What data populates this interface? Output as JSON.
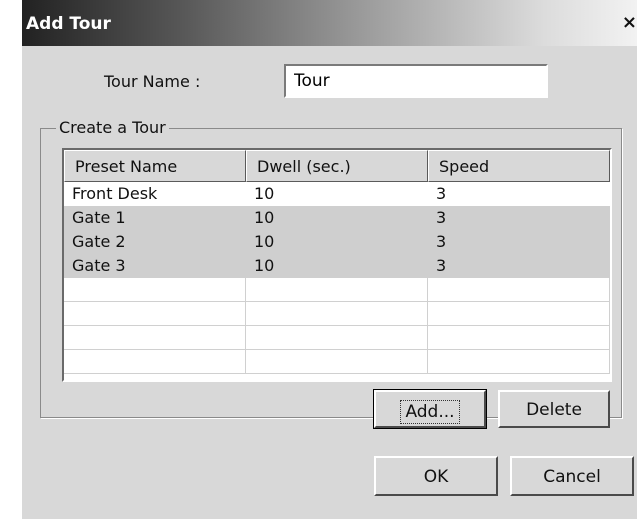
{
  "window": {
    "title": "Add Tour",
    "close_glyph": "×",
    "close_icon": "close-icon"
  },
  "tour_name": {
    "label": "Tour Name :",
    "value": "Tour"
  },
  "group": {
    "legend": "Create a Tour"
  },
  "table": {
    "columns": [
      "Preset Name",
      "Dwell (sec.)",
      "Speed"
    ],
    "rows": [
      [
        "Front Desk",
        "10",
        "3"
      ],
      [
        "Gate 1",
        "10",
        "3"
      ],
      [
        "Gate 2",
        "10",
        "3"
      ],
      [
        "Gate 3",
        "10",
        "3"
      ]
    ]
  },
  "buttons": {
    "add": "Add...",
    "delete": "Delete",
    "ok": "OK",
    "cancel": "Cancel"
  }
}
